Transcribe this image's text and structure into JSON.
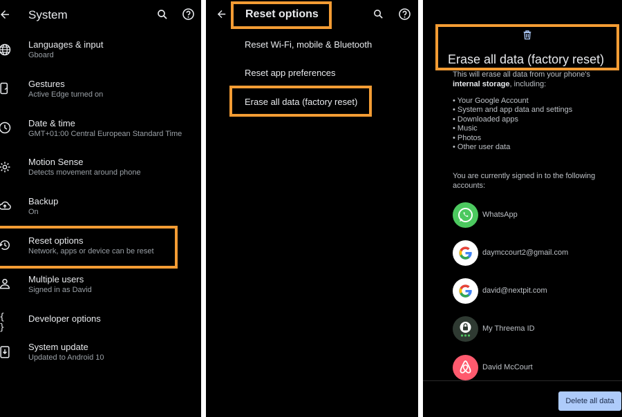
{
  "panel1": {
    "title": "System",
    "items": [
      {
        "title": "Languages & input",
        "subtitle": "Gboard",
        "icon": "globe-icon"
      },
      {
        "title": "Gestures",
        "subtitle": "Active Edge turned on",
        "icon": "phone-gesture-icon"
      },
      {
        "title": "Date & time",
        "subtitle": "GMT+01:00 Central European Standard Time",
        "icon": "clock-icon"
      },
      {
        "title": "Motion Sense",
        "subtitle": "Detects movement around phone",
        "icon": "motion-sense-icon"
      },
      {
        "title": "Backup",
        "subtitle": "On",
        "icon": "cloud-upload-icon"
      },
      {
        "title": "Reset options",
        "subtitle": "Network, apps or device can be reset",
        "icon": "history-icon"
      },
      {
        "title": "Multiple users",
        "subtitle": "Signed in as David",
        "icon": "person-icon"
      },
      {
        "title": "Developer options",
        "subtitle": "",
        "icon": "braces-icon"
      },
      {
        "title": "System update",
        "subtitle": "Updated to Android 10",
        "icon": "system-update-icon"
      }
    ]
  },
  "panel2": {
    "title": "Reset options",
    "items": [
      {
        "label": "Reset Wi-Fi, mobile & Bluetooth"
      },
      {
        "label": "Reset app preferences"
      },
      {
        "label": "Erase all data (factory reset)"
      }
    ]
  },
  "panel3": {
    "title": "Erase all data (factory reset)",
    "intro_line1": "This will erase all data from your phone's",
    "intro_bold": "internal storage",
    "intro_rest": ", including:",
    "bullets": [
      "• Your Google Account",
      "• System and app data and settings",
      "• Downloaded apps",
      "• Music",
      "• Photos",
      "• Other user data"
    ],
    "accounts_intro": "You are currently signed in to the following accounts:",
    "accounts": [
      {
        "name": "WhatsApp",
        "icon": "whatsapp-icon"
      },
      {
        "name": "daymccourt2@gmail.com",
        "icon": "google-icon"
      },
      {
        "name": "david@nextpit.com",
        "icon": "google-icon"
      },
      {
        "name": "My Threema ID",
        "icon": "threema-icon"
      },
      {
        "name": "David McCourt",
        "icon": "airbnb-icon"
      }
    ],
    "delete_button": "Delete all data"
  },
  "colors": {
    "highlight": "#f39c34",
    "background": "#000000",
    "button": "#aecbfa"
  }
}
